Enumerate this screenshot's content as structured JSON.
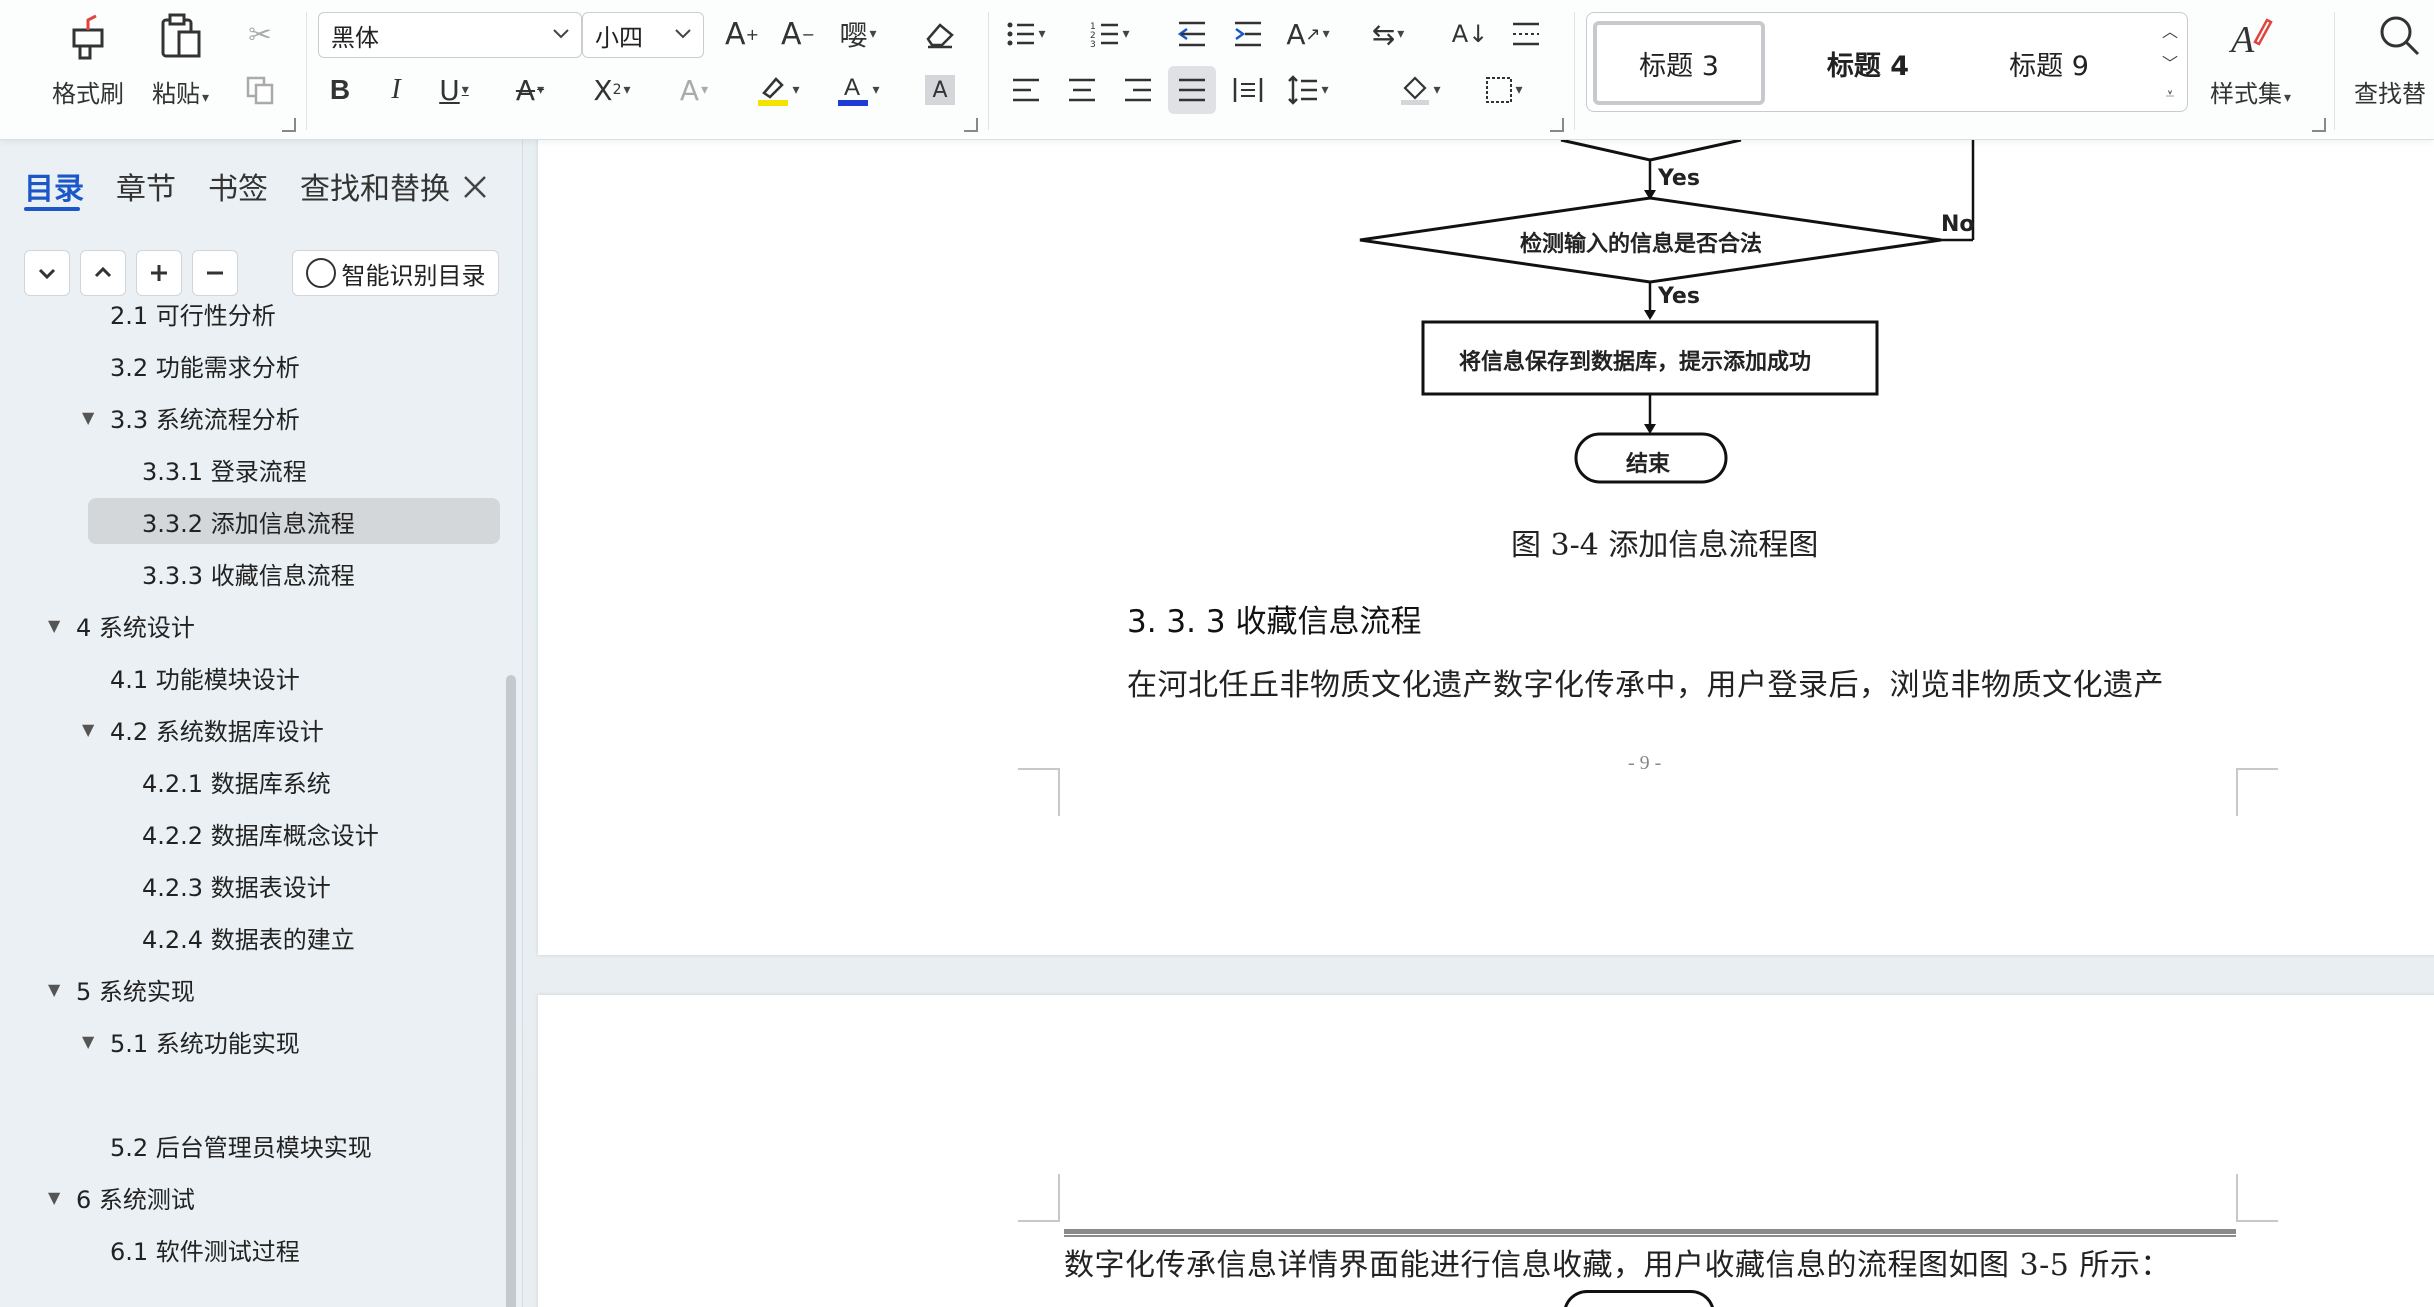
{
  "ribbon": {
    "format_painter": "格式刷",
    "paste": "粘贴",
    "font_name": "黑体",
    "font_size": "小四",
    "style_gallery": [
      "标题 3",
      "标题 4",
      "标题 9"
    ],
    "style_set": "样式集",
    "find_replace": "查找替"
  },
  "sidebar": {
    "tabs": [
      "目录",
      "章节",
      "书签",
      "查找和替换"
    ],
    "smart_toc": "智能识别目录",
    "toc": [
      {
        "label": "2.1  可行性分析",
        "level": 2
      },
      {
        "label": "3.2  功能需求分析",
        "level": 2
      },
      {
        "label": "3.3  系统流程分析",
        "level": 2,
        "expanded": true
      },
      {
        "label": "3.3.1  登录流程",
        "level": 3
      },
      {
        "label": "3.3.2  添加信息流程",
        "level": 3,
        "selected": true
      },
      {
        "label": "3.3.3  收藏信息流程",
        "level": 3
      },
      {
        "label": "4    系统设计",
        "level": 1,
        "expanded": true
      },
      {
        "label": "4.1  功能模块设计",
        "level": 2
      },
      {
        "label": "4.2  系统数据库设计",
        "level": 2,
        "expanded": true
      },
      {
        "label": "4.2.1  数据库系统",
        "level": 3
      },
      {
        "label": "4.2.2  数据库概念设计",
        "level": 3
      },
      {
        "label": "4.2.3  数据表设计",
        "level": 3
      },
      {
        "label": "4.2.4  数据表的建立",
        "level": 3
      },
      {
        "label": "5    系统实现",
        "level": 1,
        "expanded": true
      },
      {
        "label": "5.1 系统功能实现",
        "level": 2,
        "expanded": true
      },
      {
        "label": "5.2 后台管理员模块实现",
        "level": 2
      },
      {
        "label": "6    系统测试",
        "level": 1,
        "expanded": true
      },
      {
        "label": "6.1 软件测试过程",
        "level": 2
      }
    ]
  },
  "document": {
    "flowchart": {
      "yes1": "Yes",
      "decision": "检测输入的信息是否合法",
      "no": "No",
      "yes2": "Yes",
      "process": "将信息保存到数据库，提示添加成功",
      "end": "结束"
    },
    "caption": "图 3-4  添加信息流程图",
    "heading": "3. 3. 3  收藏信息流程",
    "paragraph1": "在河北任丘非物质文化遗产数字化传承中，用户登录后，浏览非物质文化遗产",
    "page_number": "- 9 -",
    "paragraph2": "数字化传承信息详情界面能进行信息收藏，用户收藏信息的流程图如图 3-5 所示："
  },
  "colors": {
    "accent": "#1a57c9",
    "selected_item": "#d3d7da",
    "sidebar_bg": "#eaf0f3",
    "highlight_yellow": "#f4e300",
    "font_color_blue": "#1f3bd6"
  },
  "icons": [
    "format-painter-icon",
    "paste-icon",
    "cut-icon",
    "copy-icon",
    "grow-font-icon",
    "shrink-font-icon",
    "phonetic-icon",
    "eraser-icon",
    "bullet-list-icon",
    "numbered-list-icon",
    "outdent-icon",
    "indent-icon",
    "text-direction-icon",
    "sort-icon",
    "column-icon",
    "bold-icon",
    "italic-icon",
    "underline-icon",
    "strikethrough-icon",
    "superscript-icon",
    "text-effect-icon",
    "highlight-icon",
    "font-color-icon",
    "char-shading-icon",
    "align-left-icon",
    "align-center-icon",
    "align-right-icon",
    "justify-icon",
    "distributed-icon",
    "line-spacing-icon",
    "shading-icon",
    "border-icon",
    "style-set-icon",
    "search-icon",
    "close-icon",
    "smart-toc-icon"
  ]
}
